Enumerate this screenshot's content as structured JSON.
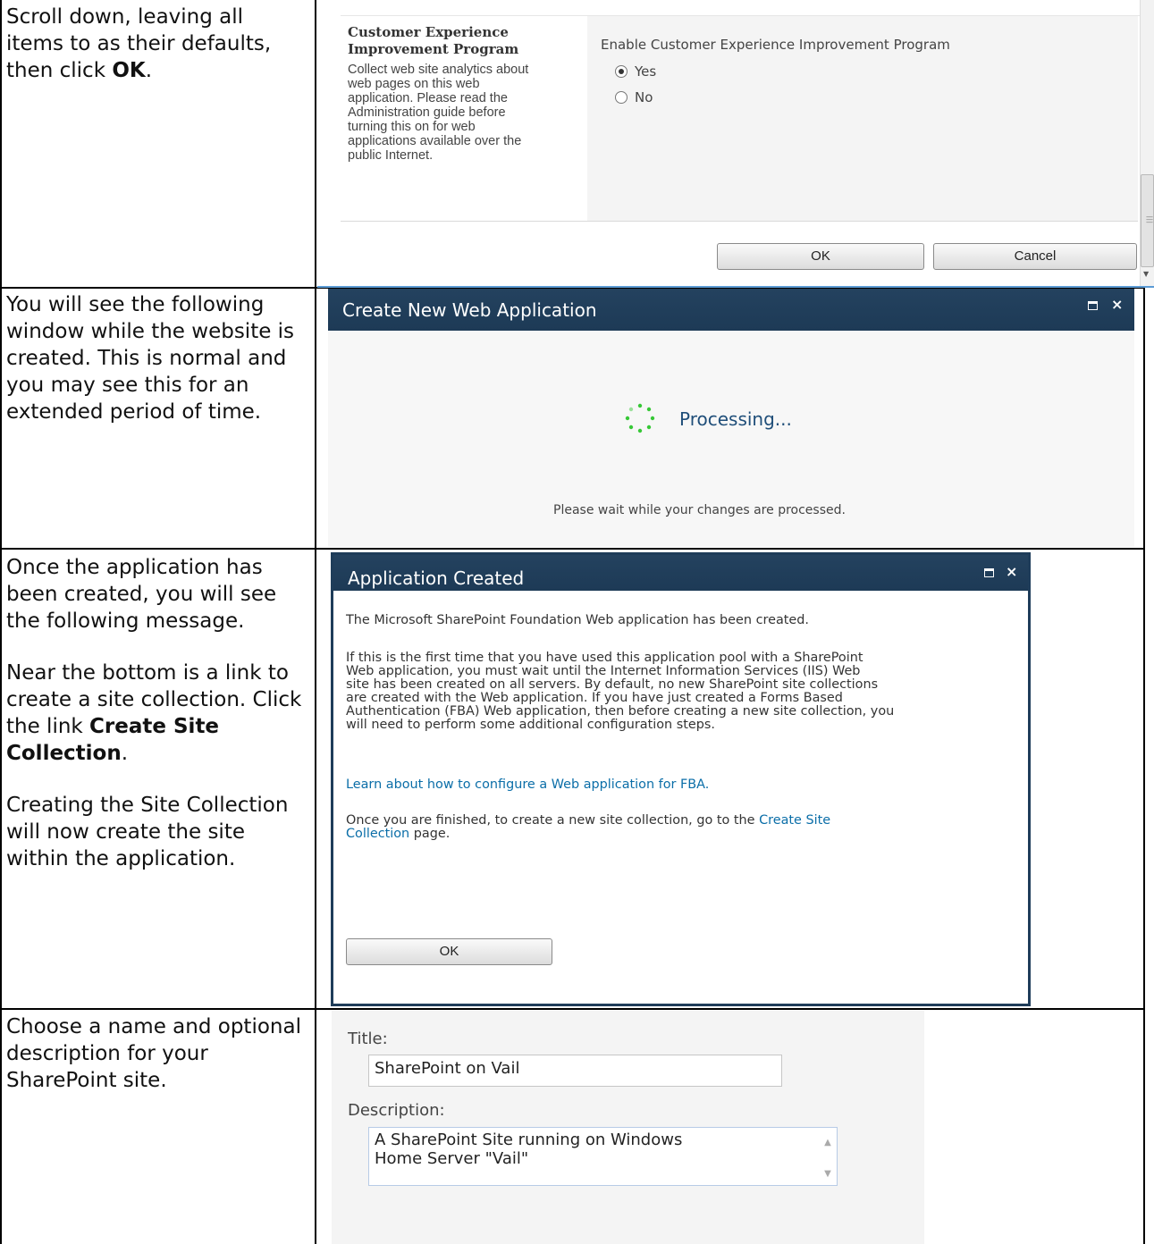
{
  "rows": [
    {
      "instruction": [
        "Scroll down, leaving all items to as their defaults, then click ",
        "OK",
        "."
      ]
    },
    {
      "instruction": "You will see the following window while the website is created. This is normal and you may see this for an extended period of time."
    },
    {
      "instruction_p1": "Once the application has been created, you will see the following message.",
      "instruction_p2": [
        "Near the bottom is a link to create a site collection. Click the link ",
        "Create Site Collection",
        "."
      ],
      "instruction_p3": "Creating the Site Collection will now create the site within the application."
    },
    {
      "instruction": "Choose a name and optional description for your SharePoint site."
    }
  ],
  "ceip": {
    "title_line1": "Customer Experience",
    "title_line2": "Improvement Program",
    "description": [
      "Collect web site analytics about",
      "web pages on this web",
      "application. Please read the",
      "Administration guide before",
      "turning this on for web",
      "applications available over the",
      "public Internet."
    ],
    "option_label": "Enable Customer Experience Improvement Program",
    "yes_label": "Yes",
    "no_label": "No",
    "selected": "Yes",
    "ok_label": "OK",
    "cancel_label": "Cancel"
  },
  "processing_dialog": {
    "title": "Create New Web Application",
    "status": "Processing...",
    "message": "Please wait while your changes are processed."
  },
  "created_dialog": {
    "title": "Application Created",
    "line1": "The Microsoft SharePoint Foundation Web application has been created.",
    "para2": [
      "If this is the first time that you have used this application pool with a SharePoint",
      "Web application, you must wait until the Internet Information Services (IIS) Web",
      "site has been created on all servers. By default, no new SharePoint site collections",
      "are created with the Web application. If you have just created a Forms Based",
      "Authentication (FBA) Web application, then before creating a new site collection, you",
      "will need to perform some additional configuration steps."
    ],
    "learn_link": "Learn about how to configure a Web application for FBA.",
    "finish_text": "Once you are finished, to create a new site collection, go to the ",
    "create_link_1": "Create Site",
    "create_link_2": "Collection",
    "finish_tail": " page.",
    "ok_label": "OK"
  },
  "site_form": {
    "title_label": "Title:",
    "title_value": "SharePoint on Vail",
    "description_label": "Description:",
    "description_lines": [
      "A SharePoint Site running on Windows",
      "Home Server \"Vail\""
    ]
  },
  "colors": {
    "dialog_header": "#1f3d5a",
    "link": "#0b6ea8",
    "spinner": "#37c837"
  }
}
